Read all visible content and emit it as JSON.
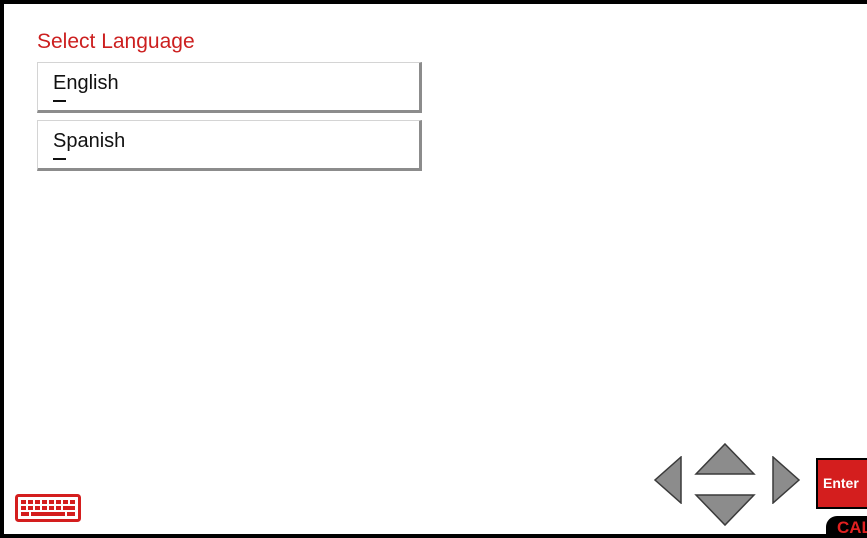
{
  "screen": {
    "title": "Select Language"
  },
  "languages": [
    {
      "label": "English",
      "mnemonic": "E"
    },
    {
      "label": "Spanish",
      "mnemonic": "S"
    }
  ],
  "controls": {
    "keyboard_icon": "keyboard-icon",
    "nav_icons": [
      "arrow-left-icon",
      "arrow-up-icon",
      "arrow-down-icon",
      "arrow-right-icon"
    ],
    "enter_label": "Enter",
    "cal_label": "CAL"
  },
  "colors": {
    "accent": "#cc1f1f",
    "button_red": "#d41e1e",
    "arrow_gray": "#8c8c8c"
  }
}
